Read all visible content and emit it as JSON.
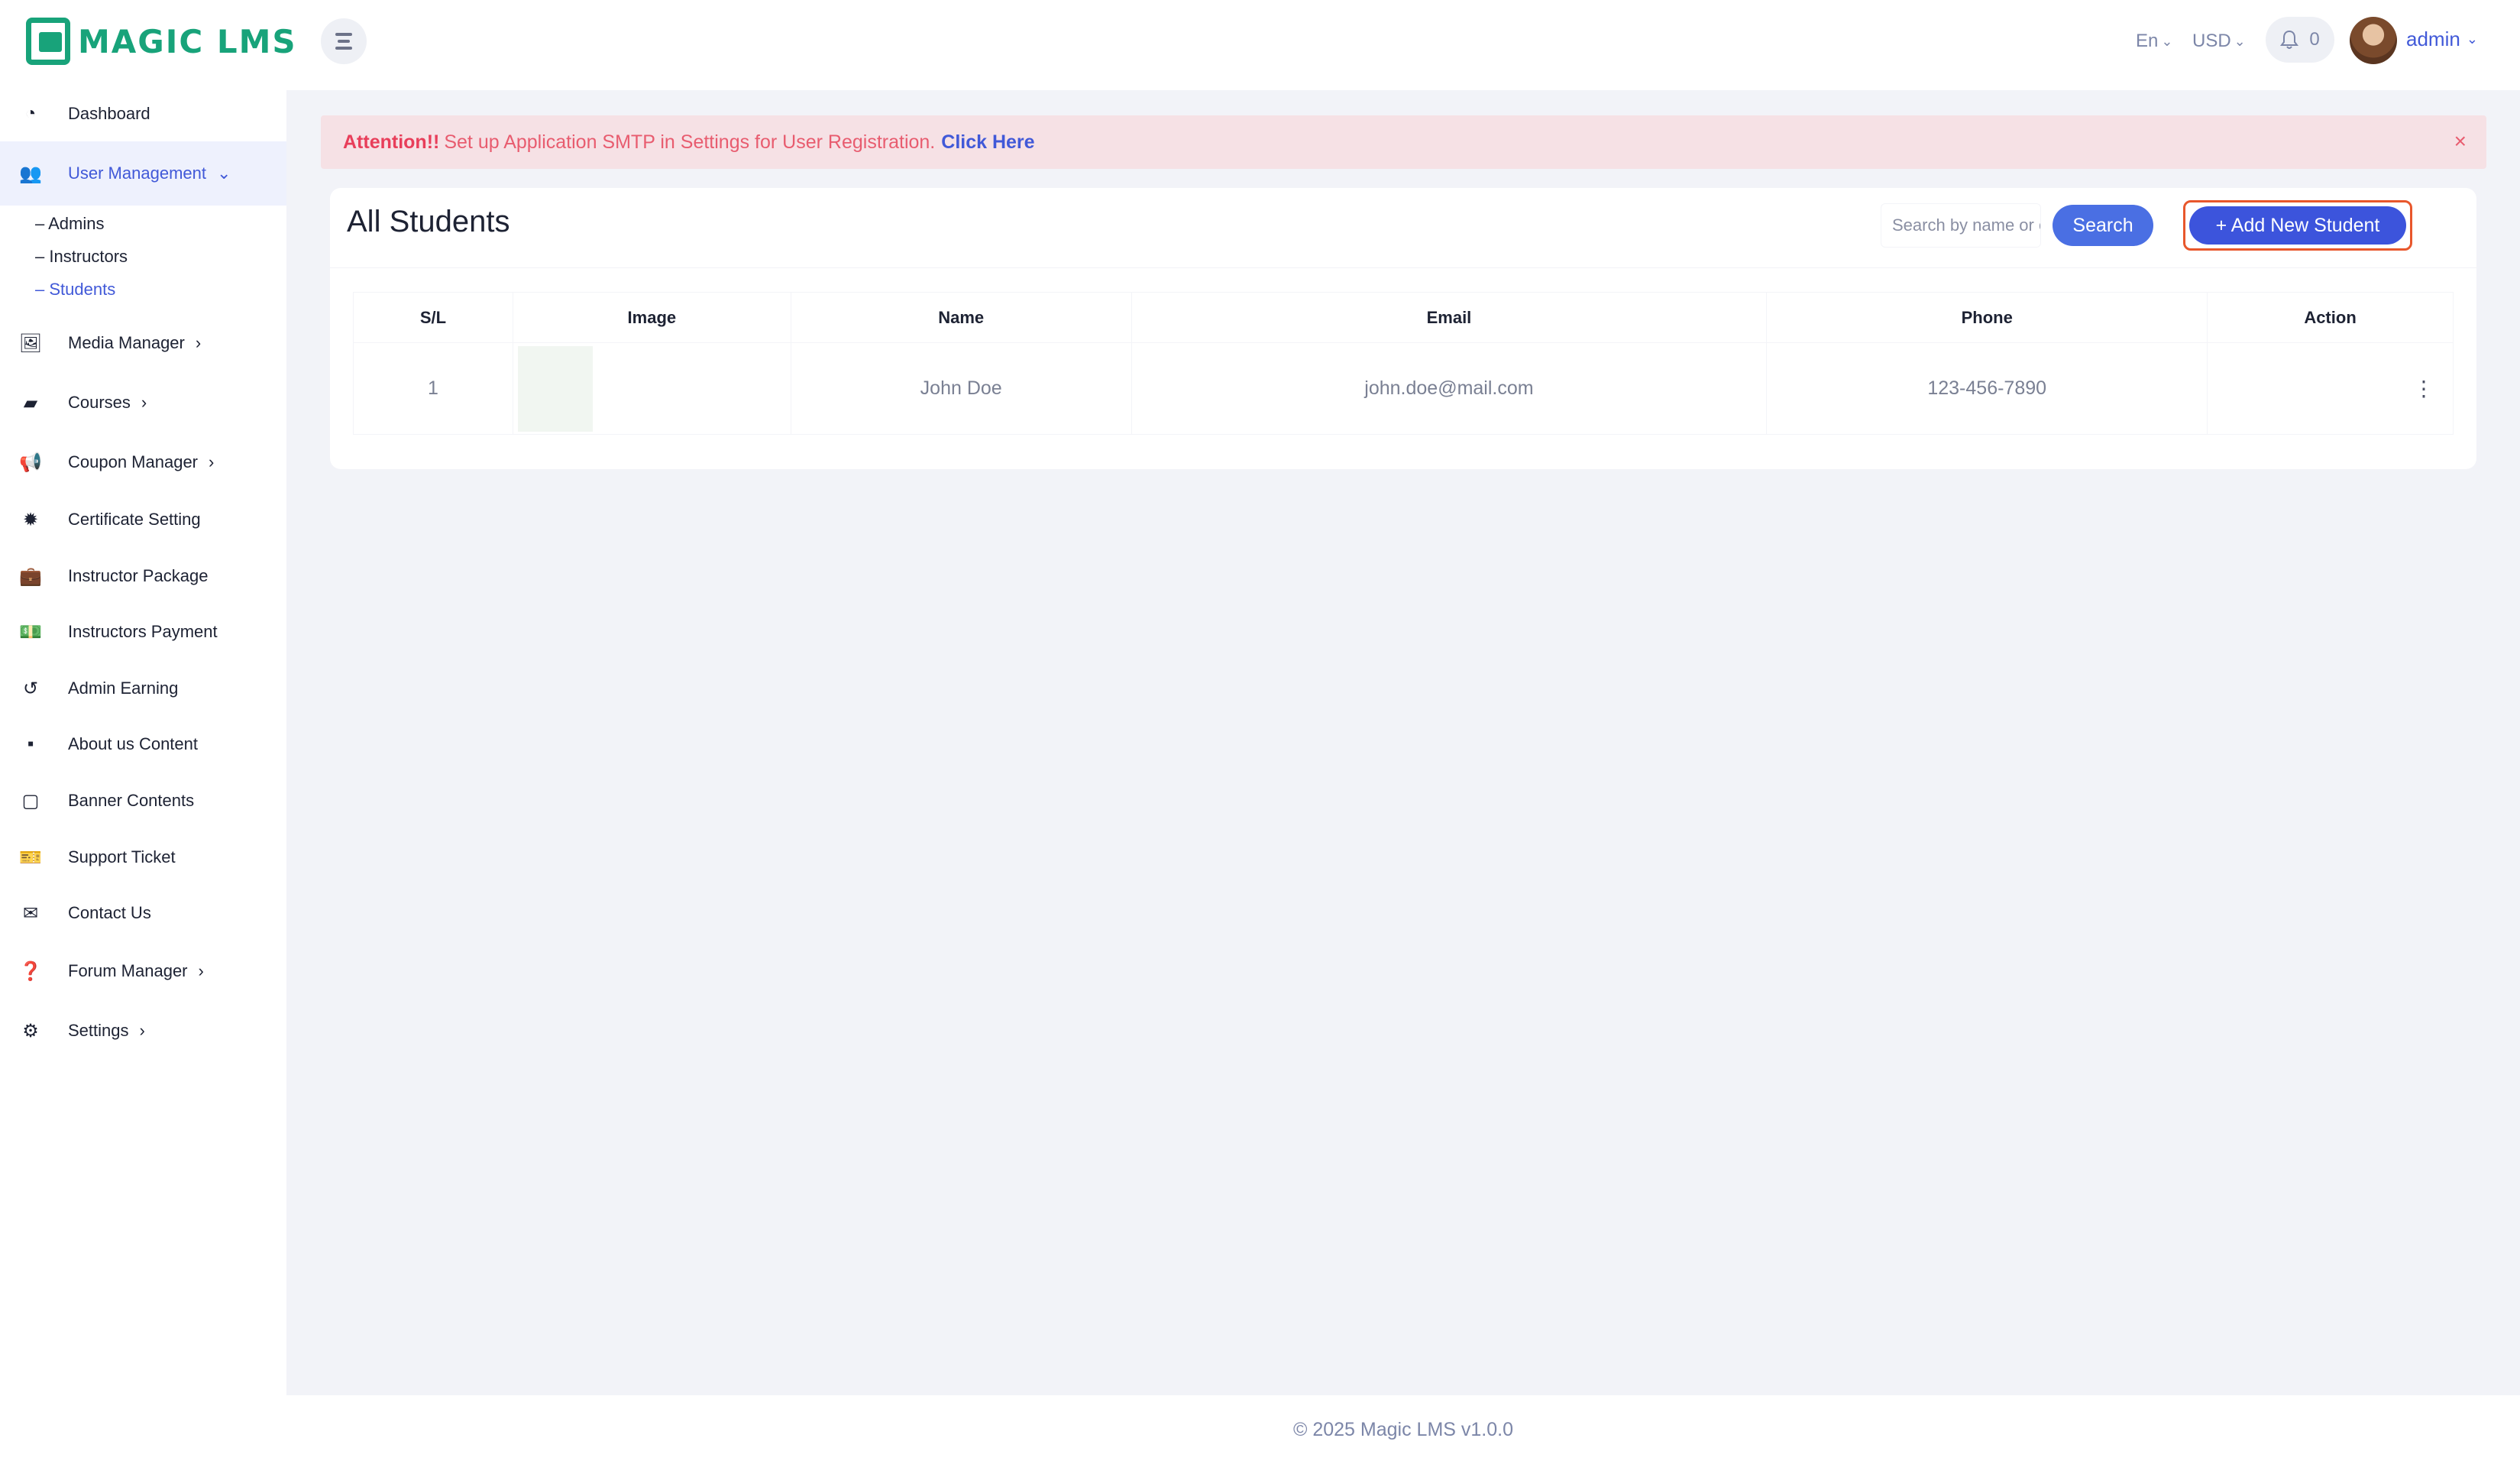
{
  "app": {
    "logo_text": "MAGIC LMS"
  },
  "header": {
    "language": "En",
    "currency": "USD",
    "notification_count": "0",
    "user_name": "admin"
  },
  "sidebar": {
    "items": [
      {
        "label": "Dashboard",
        "icon": "dashboard-icon"
      },
      {
        "label": "User Management",
        "icon": "users-icon"
      },
      {
        "label": "Media Manager",
        "icon": "image-icon"
      },
      {
        "label": "Courses",
        "icon": "book-icon"
      },
      {
        "label": "Coupon Manager",
        "icon": "megaphone-icon"
      },
      {
        "label": "Certificate Setting",
        "icon": "certificate-icon"
      },
      {
        "label": "Instructor Package",
        "icon": "briefcase-icon"
      },
      {
        "label": "Instructors Payment",
        "icon": "money-icon"
      },
      {
        "label": "Admin Earning",
        "icon": "history-icon"
      },
      {
        "label": "About us Content",
        "icon": "note-icon"
      },
      {
        "label": "Banner Contents",
        "icon": "sticky-note-icon"
      },
      {
        "label": "Support Ticket",
        "icon": "ticket-icon"
      },
      {
        "label": "Contact Us",
        "icon": "envelope-open-icon"
      },
      {
        "label": "Forum Manager",
        "icon": "question-circle-icon"
      },
      {
        "label": "Settings",
        "icon": "gear-icon"
      }
    ],
    "sub_items": [
      "– Admins",
      "– Instructors",
      "– Students"
    ]
  },
  "alert": {
    "strong": "Attention!!",
    "text": "Set up Application SMTP in Settings for User Registration.",
    "link": "Click Here",
    "close": "×"
  },
  "card": {
    "title": "All Students",
    "search_placeholder": "Search by name or email",
    "search_button": "Search",
    "add_button": "+ Add New Student"
  },
  "table": {
    "headers": [
      "S/L",
      "Image",
      "Name",
      "Email",
      "Phone",
      "Action"
    ],
    "rows": [
      {
        "sl": "1",
        "name": "John Doe",
        "email": "john.doe@mail.com",
        "phone": "123-456-7890"
      }
    ]
  },
  "footer": {
    "text": "© 2025 Magic LMS v1.0.0"
  },
  "colors": {
    "accent": "#4159d8",
    "brand": "#18a37a",
    "alert_bg": "#f6e1e5",
    "outline": "#e8572c"
  }
}
